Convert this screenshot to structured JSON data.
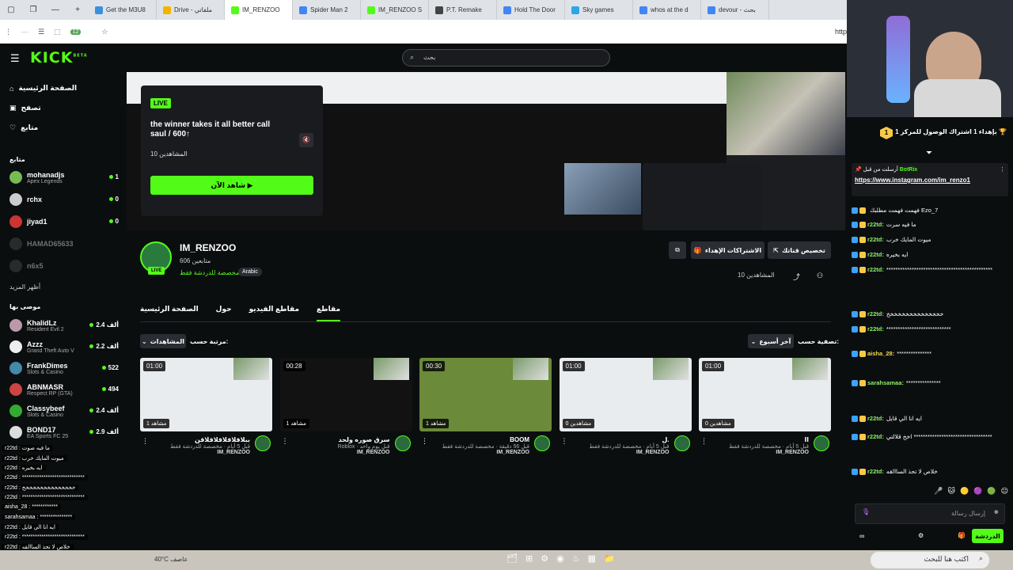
{
  "browser": {
    "tabs": [
      {
        "label": "Get the M3U8",
        "color": "#3c8fdd"
      },
      {
        "label": "Drive - ملفاتي",
        "color": "#f4b400"
      },
      {
        "label": "IM_RENZOO",
        "color": "#53fc18"
      },
      {
        "label": "Spider Man 2",
        "color": "#4285f4"
      },
      {
        "label": "IM_RENZOO S",
        "color": "#53fc18"
      },
      {
        "label": "P.T. Remake",
        "color": "#444"
      },
      {
        "label": "Hold The Door",
        "color": "#4285f4"
      },
      {
        "label": "Sky games",
        "color": "#2ea6e5"
      },
      {
        "label": "whos at the d",
        "color": "#4285f4"
      },
      {
        "label": "devour - بحث",
        "color": "#4285f4"
      }
    ],
    "url_fragment": "http",
    "ext_badge": "12"
  },
  "header": {
    "logo": "KICK",
    "logo_sup": "BETA",
    "search_placeholder": "بحث"
  },
  "sidebar": {
    "nav": [
      {
        "label": "الصفحة الرئيسية",
        "icon": "home-icon"
      },
      {
        "label": "تصفح",
        "icon": "browse-icon"
      },
      {
        "label": "متابع",
        "icon": "heart-icon"
      }
    ],
    "following_title": "متابع",
    "following": [
      {
        "name": "mohanadjs",
        "sub": "Apex Legends",
        "count": "1",
        "live": true,
        "color": "#7b5"
      },
      {
        "name": "rchx",
        "sub": "",
        "count": "0",
        "live": true,
        "color": "#ccc"
      },
      {
        "name": "jiyad1",
        "sub": "",
        "count": "0",
        "live": true,
        "color": "#c33"
      },
      {
        "name": "HAMAD65633",
        "sub": "",
        "count": "",
        "live": false,
        "color": "#555"
      },
      {
        "name": "n6x5",
        "sub": "",
        "count": "",
        "live": false,
        "color": "#555"
      }
    ],
    "show_more": "أظهر المزيد",
    "recommended_title": "موصى بها",
    "recommended": [
      {
        "name": "KhalidLz",
        "sub": "Resident Evil 2",
        "count": "2.4 ألف",
        "color": "#b9a"
      },
      {
        "name": "Azzz",
        "sub": "Grand Theft Auto V",
        "count": "2.2 ألف",
        "color": "#eee"
      },
      {
        "name": "FrankDimes",
        "sub": "Slots & Casino",
        "count": "522",
        "color": "#48a"
      },
      {
        "name": "ABNMASR",
        "sub": "Respect RP (GTA)",
        "count": "494",
        "color": "#c44"
      },
      {
        "name": "Classybeef",
        "sub": "Slots & Casino",
        "count": "2.4 ألف",
        "color": "#3a3"
      },
      {
        "name": "BOND17",
        "sub": "EA Sports FC 25",
        "count": "2.9 ألف",
        "color": "#ddd"
      }
    ]
  },
  "livecard": {
    "badge": "LIVE",
    "title": "the winner takes it all better call saul / 600↑",
    "viewers": "10 المشاهدين",
    "watch": "شاهد الآن ▶"
  },
  "channel": {
    "name": "IM_RENZOO",
    "followers": "606 متابعين",
    "chat_mode": "مخصصة للدردشة فقط",
    "language": "Arabic",
    "live_badge": "LIVE",
    "customize": "تخصيص قناتك",
    "subs": "الاشتراكات الإهداء",
    "viewers_small": "10 المشاهدين",
    "tabs": [
      "الصفحة الرئيسية",
      "حول",
      "مقاطع الفيديو",
      "مقاطع"
    ],
    "active_tab": "مقاطع",
    "filter_label": "تصفية حسب:",
    "filter_value": "آخر أسبوع",
    "sort_label": "مرتبة حسب:",
    "sort_value": "المشاهدات",
    "clips": [
      {
        "dur": "01:00",
        "views": "1 مشاهد",
        "title": "ببلاقلاقلاقلاقلاقن",
        "meta": "قبل 5 أيام · مخصصة للدردشة فقط",
        "creator": "IM_RENZOO",
        "bg": "#e8ecef"
      },
      {
        "dur": "00:28",
        "views": "1 مشاهد",
        "title": "سرق صوره ولحد",
        "meta": "Roblox · قبل يوم واحد",
        "creator": "IM_RENZOO",
        "bg": "#121212"
      },
      {
        "dur": "00:30",
        "views": "1 مشاهد",
        "title": "BOOM",
        "meta": "قبل 56 دقيقة · مخصصة للدردشة فقط",
        "creator": "IM_RENZOO",
        "bg": "#6b8a3a"
      },
      {
        "dur": "01:00",
        "views": "0 مشاهدين",
        "title": "ل.",
        "meta": "قبل 5 أيام · مخصصة للدردشة فقط",
        "creator": "IM_RENZOO",
        "bg": "#e8ecef"
      },
      {
        "dur": "01:00",
        "views": "0 مشاهدين",
        "title": "اا",
        "meta": "قبل 5 أيام · مخصصة للدردشة فقط",
        "creator": "IM_RENZOO",
        "bg": "#e8ecef"
      }
    ]
  },
  "chat": {
    "goal": "بإهداء 1 اشتراك الوصول للمركز 1 🏆",
    "goal_rank": "1",
    "pinned_user": "BotRix",
    "pinned_by": "أرسلت من قبل",
    "pinned_link": "https://www.instagram.com/im_renzo1",
    "messages": [
      {
        "user": "",
        "text": "فهمت فهمت مطلبك Ezo_7",
        "cls": "u"
      },
      {
        "user": "r22td:",
        "text": "ما فيه سرت",
        "cls": "u"
      },
      {
        "user": "r22td:",
        "text": "ميوت المايك خرب",
        "cls": "u"
      },
      {
        "user": "r22td:",
        "text": "ايه بخيره",
        "cls": "u"
      },
      {
        "user": "r22td:",
        "text": "**********************************************",
        "cls": "u"
      },
      {
        "user": "r22td:",
        "text": "خخخخخخخخخخخخخخخ",
        "cls": "u"
      },
      {
        "user": "r22td:",
        "text": "****************************",
        "cls": "u"
      },
      {
        "user": "aisha_28:",
        "text": "***************",
        "cls": "u2"
      },
      {
        "user": "sarahsamaa:",
        "text": "***************",
        "cls": "u"
      },
      {
        "user": "r22td:",
        "text": "ايه انا الي قايل",
        "cls": "u"
      },
      {
        "user": "r22td:",
        "text": "اخخ قلالتي **********************************",
        "cls": "u"
      },
      {
        "user": "r22td:",
        "text": "خلاص لا تحذ الساالقه",
        "cls": "u"
      }
    ],
    "input_placeholder": "إرسال رسالة",
    "send": "الدردشة"
  },
  "overlay": {
    "lines": [
      "r22td : ما فيه صوت",
      "r22td : ميوت المايك خرب",
      "r22td : ايه بخيره",
      "r22td : *****************************",
      "r22td : خخخخخخخخخخخخخخخ",
      "r22td : *****************************",
      "aisha_28 : ************",
      "sarahsamaa : ***************",
      "r22td : ايه انا الي قايل",
      "r22td : *****************************",
      "r22td : خلاص لا تحذ الساالقه"
    ]
  },
  "taskbar": {
    "weather": "40°C عاصف",
    "search": "اكتب هنا للبحث"
  }
}
